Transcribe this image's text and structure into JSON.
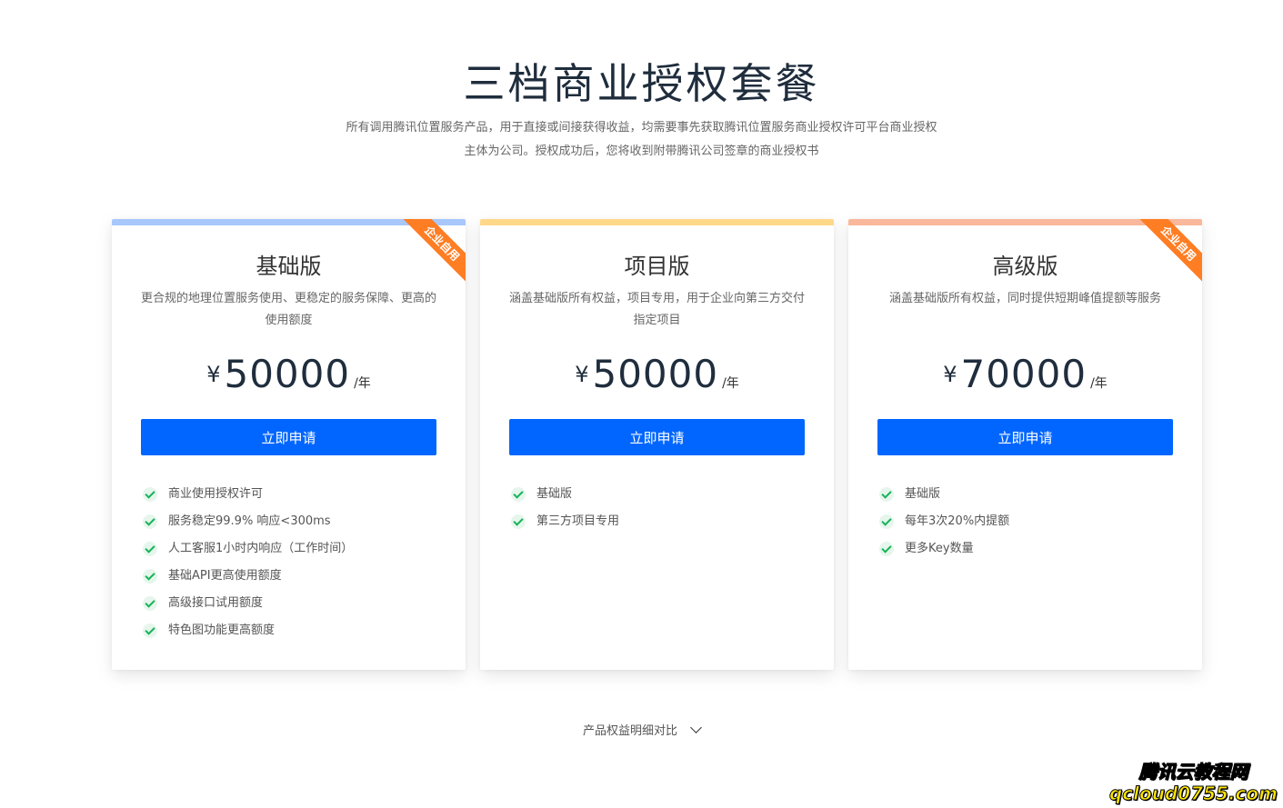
{
  "header": {
    "title": "三档商业授权套餐",
    "subtitle_line1": "所有调用腾讯位置服务产品，用于直接或间接获得收益，均需要事先获取腾讯位置服务商业授权许可平台商业授权",
    "subtitle_line2": "主体为公司。授权成功后，您将收到附带腾讯公司签章的商业授权书"
  },
  "colors": {
    "primary": "#0066ff",
    "ribbon": "#ff7d23",
    "check": "#17b35a",
    "topbar_basic": "#a8c8fb",
    "topbar_project": "#ffd88a",
    "topbar_advanced": "#f9b89b"
  },
  "plans": [
    {
      "name": "基础版",
      "ribbon": "企业自用",
      "desc": "更合规的地理位置服务使用、更稳定的服务保障、更高的使用额度",
      "currency": "¥",
      "price": "50000",
      "unit": "/年",
      "button": "立即申请",
      "features": [
        "商业使用授权许可",
        "服务稳定99.9% 响应<300ms",
        "人工客服1小时内响应（工作时间）",
        "基础API更高使用额度",
        "高级接口试用额度",
        "特色图功能更高额度"
      ]
    },
    {
      "name": "项目版",
      "ribbon": "",
      "desc": "涵盖基础版所有权益，项目专用，用于企业向第三方交付指定项目",
      "currency": "¥",
      "price": "50000",
      "unit": "/年",
      "button": "立即申请",
      "features": [
        "基础版",
        "第三方项目专用"
      ]
    },
    {
      "name": "高级版",
      "ribbon": "企业自用",
      "desc": "涵盖基础版所有权益，同时提供短期峰值提额等服务",
      "currency": "¥",
      "price": "70000",
      "unit": "/年",
      "button": "立即申请",
      "features": [
        "基础版",
        "每年3次20%内提额",
        "更多Key数量"
      ]
    }
  ],
  "compare_link": "产品权益明细对比",
  "watermark": {
    "line1": "腾讯云教程网",
    "line2": "qcloud0755.com"
  }
}
